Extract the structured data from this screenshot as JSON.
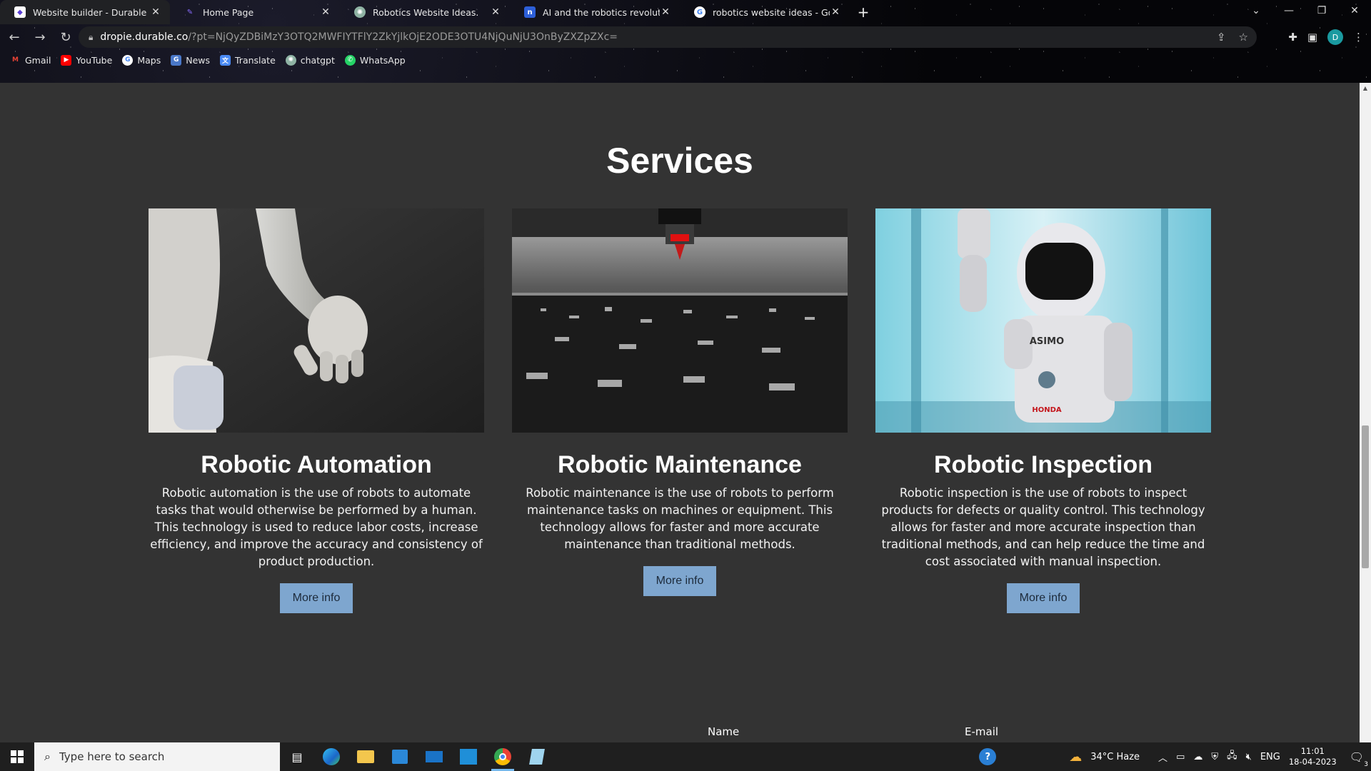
{
  "browser": {
    "tabs": [
      {
        "title": "Website builder - Durable",
        "favicon": "durable-icon",
        "active": true
      },
      {
        "title": "Home Page",
        "favicon": "durable-logo-icon",
        "active": false
      },
      {
        "title": "Robotics Website Ideas.",
        "favicon": "chatgpt-icon",
        "active": false
      },
      {
        "title": "AI and the robotics revolution W",
        "favicon": "notion-icon",
        "active": false
      },
      {
        "title": "robotics website ideas - Google",
        "favicon": "google-icon",
        "active": false
      }
    ],
    "url_host": "dropie.durable.co",
    "url_path": "/?pt=NjQyZDBiMzY3OTQ2MWFIYTFlY2ZkYjlkOjE2ODE3OTU4NjQuNjU3OnByZXZpZXc=",
    "profile_initial": "D",
    "bookmarks": [
      "Gmail",
      "YouTube",
      "Maps",
      "News",
      "Translate",
      "chatgpt",
      "WhatsApp"
    ]
  },
  "page": {
    "section_title": "Services",
    "services": [
      {
        "title": "Robotic Automation",
        "description": "Robotic automation is the use of robots to automate tasks that would otherwise be performed by a human. This technology is used to reduce labor costs, increase efficiency, and improve the accuracy and consistency of product production.",
        "button": "More info"
      },
      {
        "title": "Robotic Maintenance",
        "description": "Robotic maintenance is the use of robots to perform maintenance tasks on machines or equipment. This technology allows for faster and more accurate maintenance than traditional methods.",
        "button": "More info"
      },
      {
        "title": "Robotic Inspection",
        "description": "Robotic inspection is the use of robots to inspect products for defects or quality control. This technology allows for faster and more accurate inspection than traditional methods, and can help reduce the time and cost associated with manual inspection.",
        "button": "More info"
      }
    ],
    "form_labels": {
      "name": "Name",
      "email": "E-mail"
    },
    "image_text": {
      "asimo": "ASIMO",
      "honda": "HONDA"
    }
  },
  "taskbar": {
    "search_placeholder": "Type here to search",
    "weather": "34°C  Haze",
    "language": "ENG",
    "time": "11:01",
    "date": "18-04-2023",
    "notifications": "3"
  },
  "colors": {
    "page_bg": "#333333",
    "button_bg": "#7ea6cf",
    "accent": "#76b9ed"
  }
}
